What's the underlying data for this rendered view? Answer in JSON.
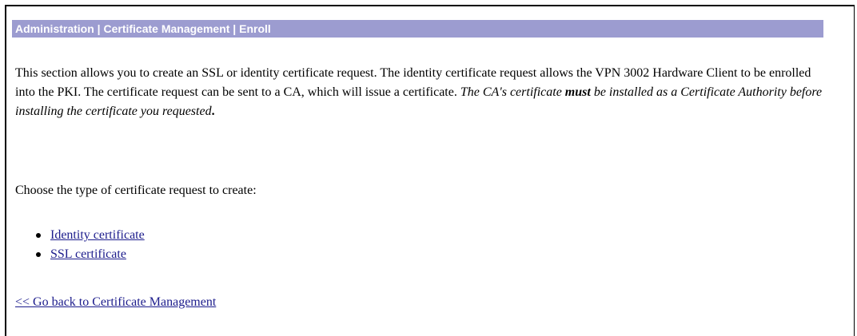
{
  "header": {
    "title": "Administration | Certificate Management | Enroll"
  },
  "description": {
    "part1": "This section allows you to create an SSL or identity certificate request. The identity certificate request allows the VPN 3002 Hardware Client to be enrolled into the PKI. The certificate request can be sent to a CA, which will issue a certificate.",
    "italic_before": "The CA's certificate",
    "italic_bold": "must",
    "italic_after": "be installed as a Certificate Authority before installing the certificate you requested",
    "period": "."
  },
  "choose_prompt": "Choose the type of certificate request to create:",
  "options": [
    {
      "label": "Identity certificate"
    },
    {
      "label": "SSL certificate"
    }
  ],
  "back_link": "<< Go back to Certificate Management",
  "colors": {
    "title_bar_bg": "#9c9cd0",
    "title_text": "#ffffff",
    "link": "#1c1c8c"
  }
}
